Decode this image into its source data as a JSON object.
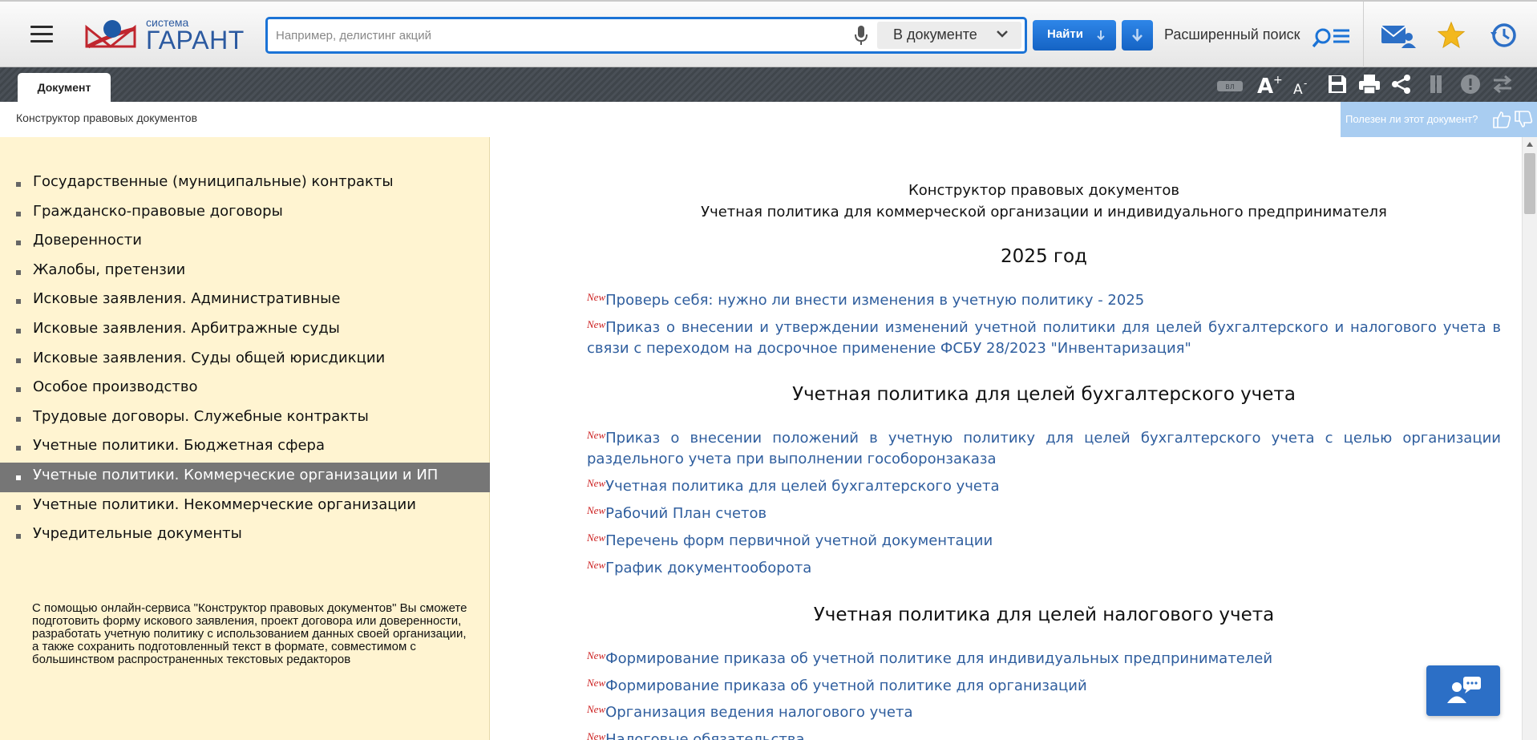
{
  "header": {
    "logo_sub": "система",
    "logo_main": "ГАРАНТ",
    "search_placeholder": "Например, делистинг акций",
    "scope_label": "В документе",
    "find_label": "Найти",
    "advanced_search_label": "Расширенный поиск"
  },
  "tabs": {
    "document": "Документ"
  },
  "breadcrumb": "Конструктор правовых документов",
  "feedback": {
    "useful_label": "Полезен ли этот документ?"
  },
  "sidebar": {
    "items": [
      "Государственные (муниципальные) контракты",
      "Гражданско-правовые договоры",
      "Доверенности",
      "Жалобы, претензии",
      "Исковые заявления. Административные",
      "Исковые заявления. Арбитражные суды",
      "Исковые заявления. Суды общей юрисдикции",
      "Особое производство",
      "Трудовые договоры. Служебные контракты",
      "Учетные политики. Бюджетная сфера",
      "Учетные политики. Коммерческие организации и ИП",
      "Учетные политики. Некоммерческие организации",
      "Учредительные документы"
    ],
    "active_index": 10,
    "note": "С помощью онлайн-сервиса \"Конструктор правовых документов\" Вы сможете подготовить форму искового заявления, проект договора или доверенности, разработать учетную политику с использованием данных своей организации, а также сохранить подготовленный текст в формате, совместимом с большинством распространенных текстовых редакторов"
  },
  "document": {
    "title1": "Конструктор правовых документов",
    "title2": "Учетная политика для коммерческой организации и индивидуального предпринимателя",
    "year_heading": "2025 год",
    "new_label": "New",
    "year_links": [
      "Проверь себя: нужно ли внести изменения в учетную политику - 2025",
      "Приказ о внесении и утверждении изменений учетной политики для целей бухгалтерского и налогового учета в связи с переходом на досрочное применение ФСБУ 28/2023 \"Инвентаризация\""
    ],
    "accounting_heading": "Учетная политика для целей бухгалтерского учета",
    "accounting_links": [
      "Приказ о внесении положений в учетную политику для целей бухгалтерского учета с целью организации раздельного учета при выполнении гособоронзаказа",
      "Учетная политика для целей бухгалтерского учета",
      "Рабочий План счетов",
      "Перечень форм первичной учетной документации",
      "График документооборота"
    ],
    "tax_heading": "Учетная политика для целей налогового учета",
    "tax_links": [
      "Формирование приказа об учетной политике для индивидуальных предпринимателей",
      "Формирование приказа об учетной политике для организаций",
      "Организация ведения налогового учета",
      "Налоговые обязательства"
    ]
  },
  "colors": {
    "accent": "#1b73d6",
    "link": "#2f5e9e",
    "new_badge": "#cc1f1f",
    "sidebar_bg": "#fff4d1",
    "active_item": "#767676"
  }
}
